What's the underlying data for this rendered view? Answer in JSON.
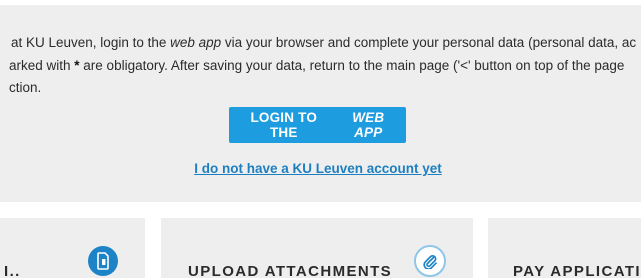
{
  "intro": {
    "line1": [
      "at KU Leuven, login to the ",
      "web app",
      " via your browser and complete your personal data (personal data, ac"
    ],
    "line2": [
      "arked with ",
      "*",
      " are obligatory. After saving your data, return to the main page ('<' button on top of the page"
    ],
    "line3": "ction."
  },
  "login_button": {
    "prefix": "LOGIN TO THE",
    "emphasis": "WEB APP"
  },
  "no_account_link": "I do not have a KU Leuven account yet",
  "cards": [
    {
      "title": "I..",
      "icon": "document-phone-icon"
    },
    {
      "title": "UPLOAD ATTACHMENTS",
      "icon": "paperclip-icon"
    },
    {
      "title": "PAY APPLICATI",
      "icon": "payment-icon"
    }
  ],
  "colors": {
    "accent": "#1d9ce0",
    "link": "#1d7fc0",
    "panel": "#eeeeee"
  }
}
